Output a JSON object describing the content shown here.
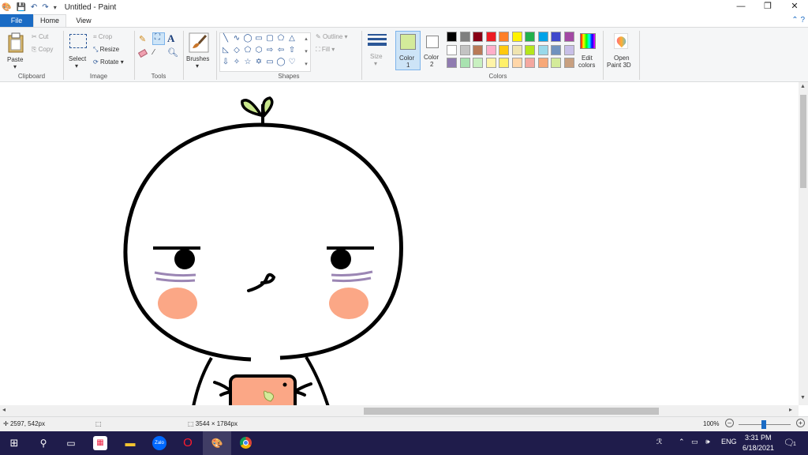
{
  "window": {
    "title": "Untitled - Paint",
    "minimize": "—",
    "restore": "❐",
    "close": "✕"
  },
  "quick_access": [
    "paint-app-icon",
    "save-icon",
    "undo-icon",
    "redo-icon"
  ],
  "menu": {
    "file": "File",
    "home": "Home",
    "view": "View",
    "help_glyphs": "⌃  ?"
  },
  "ribbon": {
    "clipboard": {
      "label": "Clipboard",
      "paste": "Paste",
      "cut": "Cut",
      "copy": "Copy"
    },
    "image": {
      "label": "Image",
      "select": "Select",
      "crop": "Crop",
      "resize": "Resize",
      "rotate": "Rotate ▾"
    },
    "tools": {
      "label": "Tools"
    },
    "brushes": {
      "label": "Brushes"
    },
    "shapes": {
      "label": "Shapes",
      "outline": "Outline ▾",
      "fill": "Fill ▾"
    },
    "size": {
      "label": "Size"
    },
    "color1": {
      "label": "Color",
      "num": "1",
      "value": "#d4eb9a"
    },
    "color2": {
      "label": "Color",
      "num": "2",
      "value": "#ffffff"
    },
    "colors": {
      "label": "Colors"
    },
    "edit_colors": {
      "line1": "Edit",
      "line2": "colors"
    },
    "paint3d": {
      "line1": "Open",
      "line2": "Paint 3D"
    }
  },
  "palette": [
    [
      "#000000",
      "#7f7f7f",
      "#880015",
      "#ed1c24",
      "#ff7f27",
      "#fff200",
      "#22b14c",
      "#00a2e8",
      "#3f48cc",
      "#a349a4"
    ],
    [
      "#ffffff",
      "#c3c3c3",
      "#b97a57",
      "#ffaec9",
      "#ffc90e",
      "#efe4b0",
      "#b5e61d",
      "#99d9ea",
      "#7092be",
      "#c8bfe7"
    ],
    [
      "#8f7bb0",
      "#a8e2b0",
      "#c8f0c0",
      "#fff4a8",
      "#fff06a",
      "#ffd6a8",
      "#f4a8a0",
      "#f7a878",
      "#d4eb9a",
      "#c8a080"
    ]
  ],
  "status": {
    "cursor_pos": "2597, 542px",
    "canvas_size": "3544 × 1784px",
    "zoom": "100%",
    "zoom_out": "–",
    "zoom_in": "+"
  },
  "taskbar": {
    "time": "3:31 PM",
    "date": "6/18/2021",
    "lang": "ENG",
    "notification_count": "1",
    "apps": [
      "windows-start-icon",
      "search-icon",
      "task-view-icon",
      "store-icon",
      "file-explorer-icon",
      "zalo-icon",
      "opera-icon",
      "paint-icon",
      "chrome-icon"
    ]
  },
  "drawing": {
    "leaf_color": "#c9e78c",
    "blush_color": "#fba786",
    "eyebag_color": "#9b86b4",
    "phone_color": "#fba786",
    "heart_color": "#d4eb9a"
  }
}
